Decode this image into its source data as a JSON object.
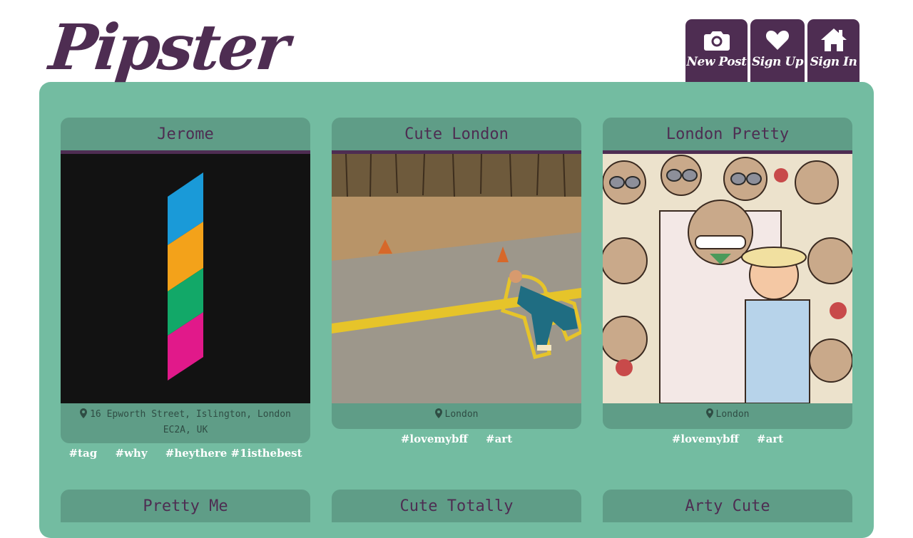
{
  "brand": {
    "name": "Pipster",
    "color": "#4e2d52"
  },
  "nav": [
    {
      "label": "New Post",
      "icon": "camera-icon"
    },
    {
      "label": "Sign Up",
      "icon": "heart-icon"
    },
    {
      "label": "Sign In",
      "icon": "home-icon"
    }
  ],
  "colors": {
    "accent": "#4e2d52",
    "panel": "#73bca1",
    "card": "#5f9d87"
  },
  "posts": [
    {
      "title": "Jerome",
      "location": "16 Epworth Street, Islington, London EC2A, UK",
      "tags": [
        "#tag",
        "#why",
        "#heythere #1isthebest"
      ],
      "image": "striped-parallelogram-artwork"
    },
    {
      "title": "Cute London",
      "location": "London",
      "tags": [
        "#lovemybff",
        "#art"
      ],
      "image": "road-chalk-outline-photo"
    },
    {
      "title": "London Pretty",
      "location": "London",
      "tags": [
        "#lovemybff",
        "#art"
      ],
      "image": "cartoon-crowd-illustration"
    },
    {
      "title": "Pretty Me"
    },
    {
      "title": "Cute Totally"
    },
    {
      "title": "Arty Cute"
    }
  ]
}
